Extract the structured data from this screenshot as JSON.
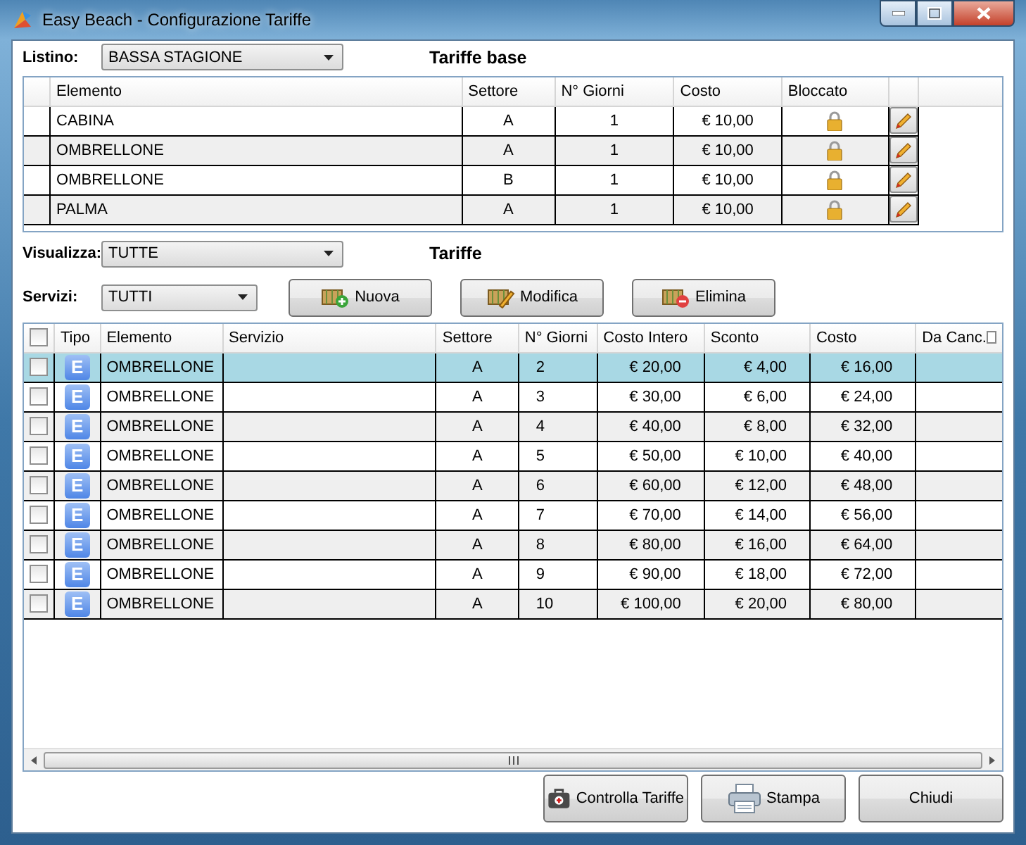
{
  "window": {
    "title": "Easy Beach - Configurazione Tariffe"
  },
  "listino": {
    "label": "Listino:",
    "value": "BASSA STAGIONE"
  },
  "base_title": "Tariffe base",
  "base_table": {
    "columns": [
      "Elemento",
      "Settore",
      "N° Giorni",
      "Costo",
      "Bloccato"
    ],
    "rows": [
      {
        "elemento": "CABINA",
        "settore": "A",
        "giorni": "1",
        "costo": "€ 10,00",
        "locked": true
      },
      {
        "elemento": "OMBRELLONE",
        "settore": "A",
        "giorni": "1",
        "costo": "€ 10,00",
        "locked": true
      },
      {
        "elemento": "OMBRELLONE",
        "settore": "B",
        "giorni": "1",
        "costo": "€ 10,00",
        "locked": true
      },
      {
        "elemento": "PALMA",
        "settore": "A",
        "giorni": "1",
        "costo": "€ 10,00",
        "locked": true
      }
    ]
  },
  "visualizza": {
    "label": "Visualizza:",
    "value": "TUTTE"
  },
  "tariffe_title": "Tariffe",
  "servizi": {
    "label": "Servizi:",
    "value": "TUTTI"
  },
  "actions": [
    {
      "kind": "new",
      "label": "Nuova"
    },
    {
      "kind": "edit",
      "label": "Modifica"
    },
    {
      "kind": "delete",
      "label": "Elimina"
    }
  ],
  "table": {
    "header_checked": false,
    "columns": [
      "Tipo",
      "Elemento",
      "Servizio",
      "Settore",
      "N° Giorni",
      "Costo Intero",
      "Sconto",
      "Costo",
      "Da Canc."
    ],
    "rows": [
      {
        "selected": true,
        "checked": false,
        "tipo": "E",
        "elemento": "OMBRELLONE",
        "settore": "A",
        "giorni": "2",
        "costo_intero": "€ 20,00",
        "sconto": "€ 4,00",
        "costo": "€ 16,00"
      },
      {
        "selected": false,
        "checked": false,
        "tipo": "E",
        "elemento": "OMBRELLONE",
        "settore": "A",
        "giorni": "3",
        "costo_intero": "€ 30,00",
        "sconto": "€ 6,00",
        "costo": "€ 24,00"
      },
      {
        "selected": false,
        "checked": false,
        "tipo": "E",
        "elemento": "OMBRELLONE",
        "settore": "A",
        "giorni": "4",
        "costo_intero": "€ 40,00",
        "sconto": "€ 8,00",
        "costo": "€ 32,00"
      },
      {
        "selected": false,
        "checked": false,
        "tipo": "E",
        "elemento": "OMBRELLONE",
        "settore": "A",
        "giorni": "5",
        "costo_intero": "€ 50,00",
        "sconto": "€ 10,00",
        "costo": "€ 40,00"
      },
      {
        "selected": false,
        "checked": false,
        "tipo": "E",
        "elemento": "OMBRELLONE",
        "settore": "A",
        "giorni": "6",
        "costo_intero": "€ 60,00",
        "sconto": "€ 12,00",
        "costo": "€ 48,00"
      },
      {
        "selected": false,
        "checked": false,
        "tipo": "E",
        "elemento": "OMBRELLONE",
        "settore": "A",
        "giorni": "7",
        "costo_intero": "€ 70,00",
        "sconto": "€ 14,00",
        "costo": "€ 56,00"
      },
      {
        "selected": false,
        "checked": false,
        "tipo": "E",
        "elemento": "OMBRELLONE",
        "settore": "A",
        "giorni": "8",
        "costo_intero": "€ 80,00",
        "sconto": "€ 16,00",
        "costo": "€ 64,00"
      },
      {
        "selected": false,
        "checked": false,
        "tipo": "E",
        "elemento": "OMBRELLONE",
        "settore": "A",
        "giorni": "9",
        "costo_intero": "€ 90,00",
        "sconto": "€ 18,00",
        "costo": "€ 72,00"
      },
      {
        "selected": false,
        "checked": false,
        "tipo": "E",
        "elemento": "OMBRELLONE",
        "settore": "A",
        "giorni": "10",
        "costo_intero": "€ 100,00",
        "sconto": "€ 20,00",
        "costo": "€ 80,00"
      }
    ]
  },
  "footer_buttons": [
    {
      "kind": "check",
      "label": "Controlla Tariffe"
    },
    {
      "kind": "print",
      "label": "Stampa"
    },
    {
      "kind": "close",
      "label": "Chiudi"
    }
  ]
}
